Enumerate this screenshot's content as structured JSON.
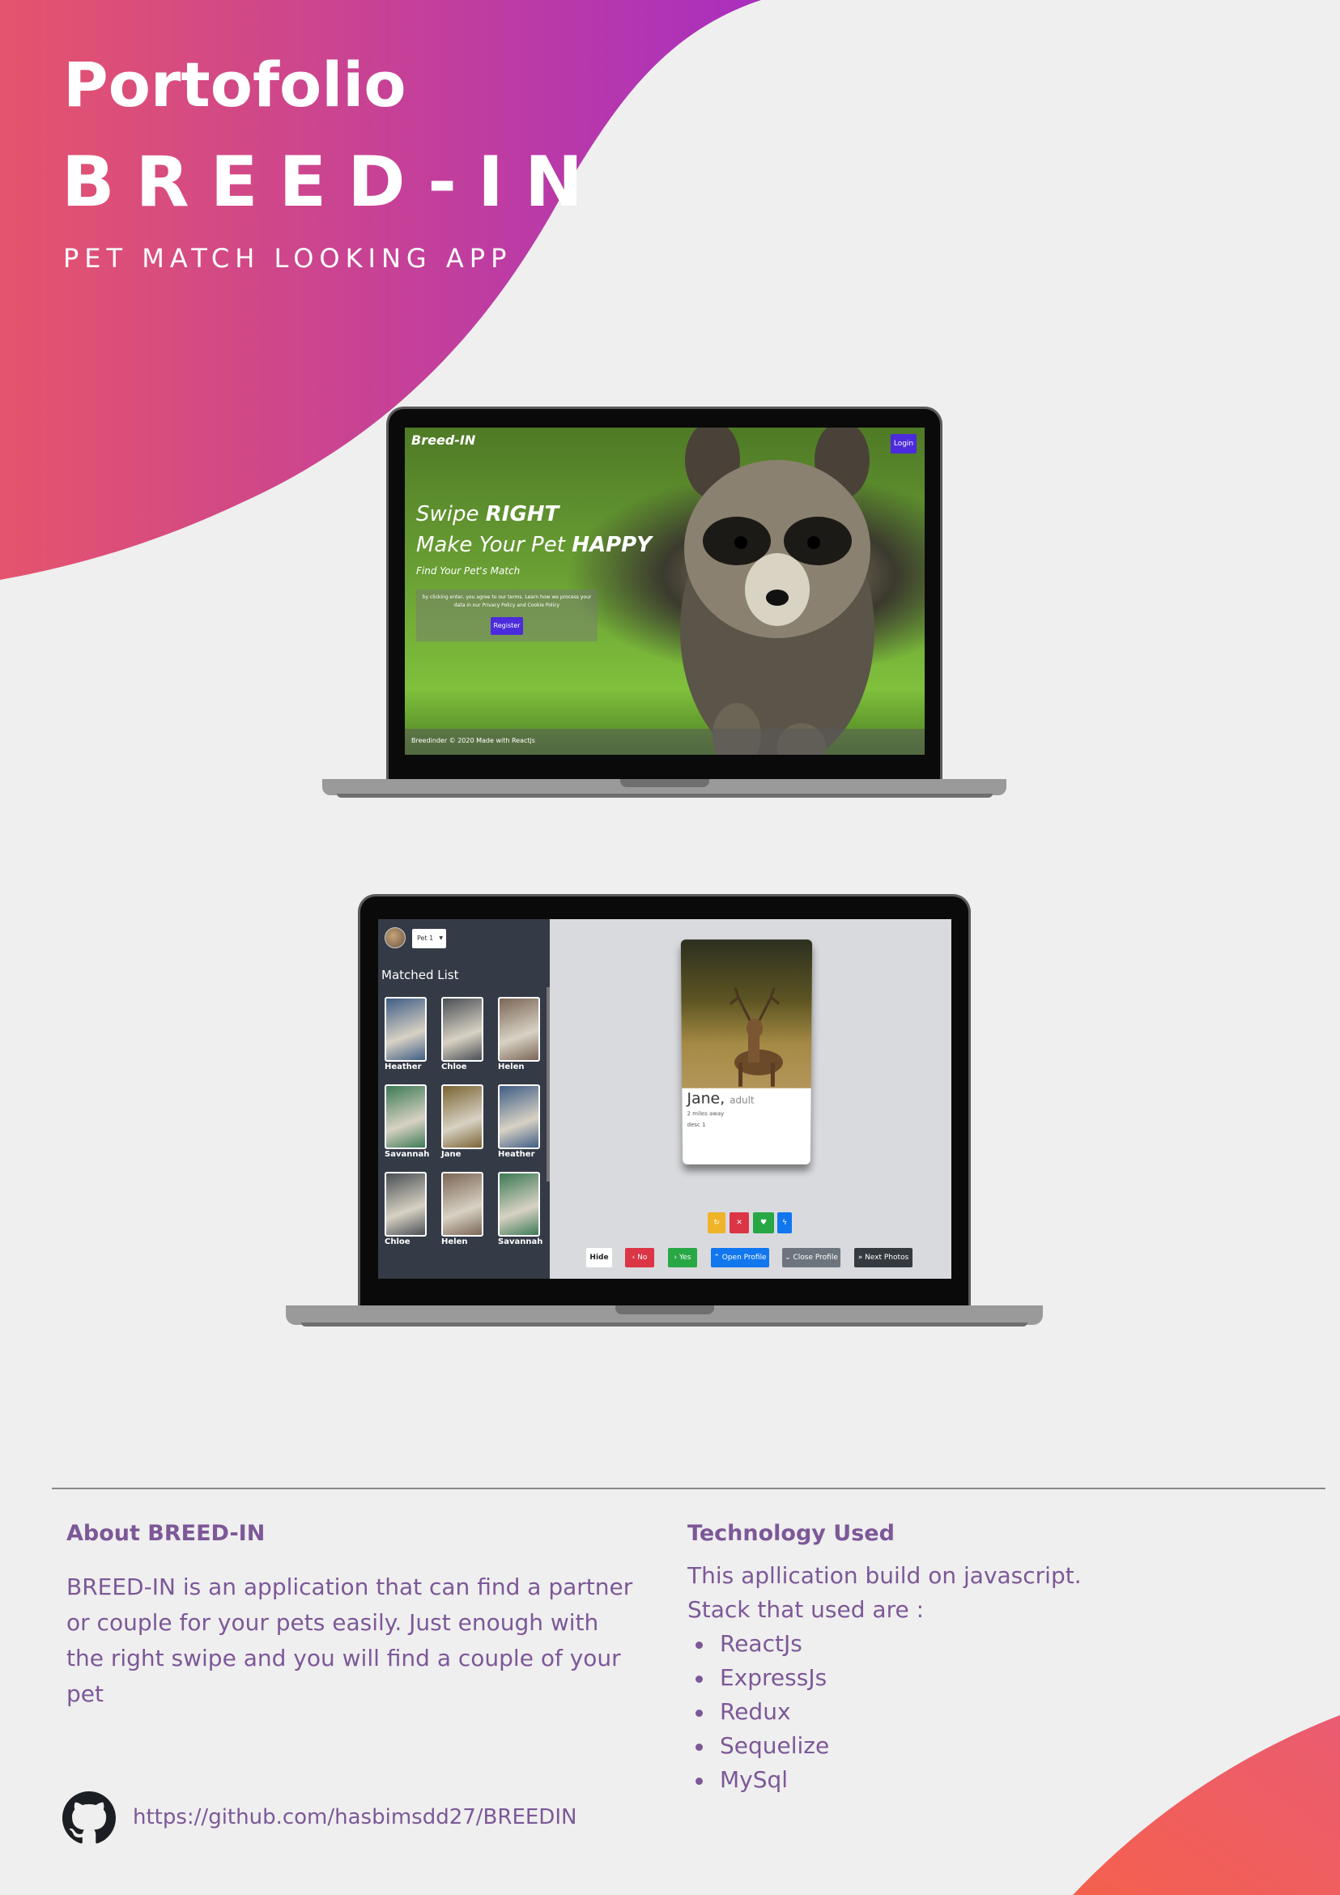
{
  "header": {
    "title": "Portofolio",
    "project_name": "BREED-IN",
    "subtitle": "PET MATCH LOOKING APP"
  },
  "colors": {
    "gradient_start": "#e5546c",
    "gradient_end": "#a92fbf",
    "corner_start": "#f5604d",
    "corner_end": "#ea5c72",
    "text_purple": "#7d5898",
    "brand_button": "#4b2bdc"
  },
  "landing_screen": {
    "brand": "Breed-IN",
    "login_label": "Login",
    "headline_line1_prefix": "Swipe ",
    "headline_line1_bold": "RIGHT",
    "headline_line2_prefix": "Make Your Pet ",
    "headline_line2_bold": "HAPPY",
    "tagline": "Find Your Pet's Match",
    "terms_text": "by clicking enter, you agree to our terms. Learn how we process your data in our Privacy Policy and Cookie Policy",
    "register_label": "Register",
    "footer_text": "Breedinder © 2020 Made with Reactjs"
  },
  "app_screen": {
    "pet_select_value": "Pet 1",
    "matched_list_title": "Matched List",
    "matches": [
      {
        "name": "Heather",
        "color": "#3f5d86"
      },
      {
        "name": "Chloe",
        "color": "#4a4f55"
      },
      {
        "name": "Helen",
        "color": "#7b6656"
      },
      {
        "name": "Savannah",
        "color": "#3c7a55"
      },
      {
        "name": "Jane",
        "color": "#7a6433"
      },
      {
        "name": "Heather",
        "color": "#3f5d86"
      },
      {
        "name": "Chloe",
        "color": "#4a4f55"
      },
      {
        "name": "Helen",
        "color": "#7b6656"
      },
      {
        "name": "Savannah",
        "color": "#3c7a55"
      }
    ],
    "card": {
      "name": "Jane,",
      "age": "adult",
      "distance": "2 miles away",
      "description": "desc 1"
    },
    "icon_buttons": [
      {
        "icon": "refresh-icon",
        "glyph": "↻",
        "color": "#f0b429"
      },
      {
        "icon": "close-icon",
        "glyph": "✕",
        "color": "#dc3545"
      },
      {
        "icon": "heart-icon",
        "glyph": "♥",
        "color": "#28a745"
      },
      {
        "icon": "bolt-icon",
        "glyph": "ϟ",
        "color": "#1177ee"
      }
    ],
    "buttons": {
      "hide": "Hide",
      "no": "No",
      "yes": "Yes",
      "open_profile": "Open Profile",
      "close_profile": "Close Profile",
      "next_photos": "Next Photos"
    }
  },
  "about": {
    "heading": "About BREED-IN",
    "text": "BREED-IN is an application that can find a partner or couple for your pets easily. Just enough with the right swipe and you will find a couple of your pet"
  },
  "technology": {
    "heading": "Technology Used",
    "intro_line1": "This apllication build on javascript.",
    "intro_line2": "Stack that used are :",
    "stack": [
      "ReactJs",
      "ExpressJs",
      "Redux",
      "Sequelize",
      "MySql"
    ]
  },
  "footer": {
    "github_url": "https://github.com/hasbimsdd27/BREEDIN"
  }
}
